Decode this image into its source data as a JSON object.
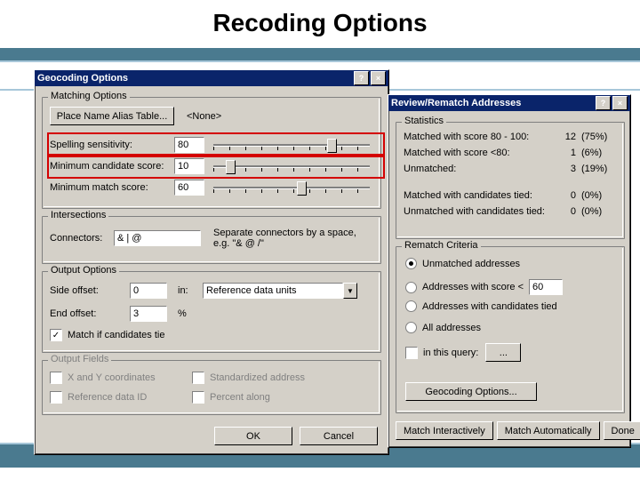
{
  "slide": {
    "title": "Recoding Options"
  },
  "geo": {
    "title": "Geocoding Options",
    "matching": {
      "group": "Matching Options",
      "alias_btn": "Place Name Alias Table...",
      "alias_value": "<None>",
      "spelling_label": "Spelling sensitivity:",
      "spelling_value": "80",
      "min_cand_label": "Minimum candidate score:",
      "min_cand_value": "10",
      "min_match_label": "Minimum match score:",
      "min_match_value": "60"
    },
    "intersections": {
      "group": "Intersections",
      "connectors_label": "Connectors:",
      "connectors_value": "& | @",
      "hint": "Separate connectors by a space, e.g. \"& @ /\""
    },
    "output": {
      "group": "Output Options",
      "side_label": "Side offset:",
      "side_value": "0",
      "side_in": "in:",
      "side_units": "Reference data units",
      "end_label": "End offset:",
      "end_value": "3",
      "end_unit": "%",
      "match_tie": "Match if candidates tie"
    },
    "fields": {
      "group": "Output Fields",
      "xy": "X and Y coordinates",
      "std": "Standardized address",
      "ref": "Reference data ID",
      "pct": "Percent along"
    },
    "ok": "OK",
    "cancel": "Cancel"
  },
  "review": {
    "title": "Review/Rematch Addresses",
    "stats": {
      "group": "Statistics",
      "r1_label": "Matched with score 80 - 100:",
      "r1_n": "12",
      "r1_p": "(75%)",
      "r2_label": "Matched with score <80:",
      "r2_n": "1",
      "r2_p": "(6%)",
      "r3_label": "Unmatched:",
      "r3_n": "3",
      "r3_p": "(19%)",
      "r4_label": "Matched with candidates tied:",
      "r4_n": "0",
      "r4_p": "(0%)",
      "r5_label": "Unmatched with candidates tied:",
      "r5_n": "0",
      "r5_p": "(0%)"
    },
    "rematch": {
      "group": "Rematch Criteria",
      "opt_unmatched": "Unmatched addresses",
      "opt_score_prefix": "Addresses with score <",
      "opt_score_value": "60",
      "opt_tied": "Addresses with candidates tied",
      "opt_all": "All addresses",
      "opt_query": "in this query:",
      "query_btn": "...",
      "geo_btn": "Geocoding Options..."
    },
    "btn_interactive": "Match Interactively",
    "btn_auto": "Match Automatically",
    "btn_done": "Done"
  }
}
